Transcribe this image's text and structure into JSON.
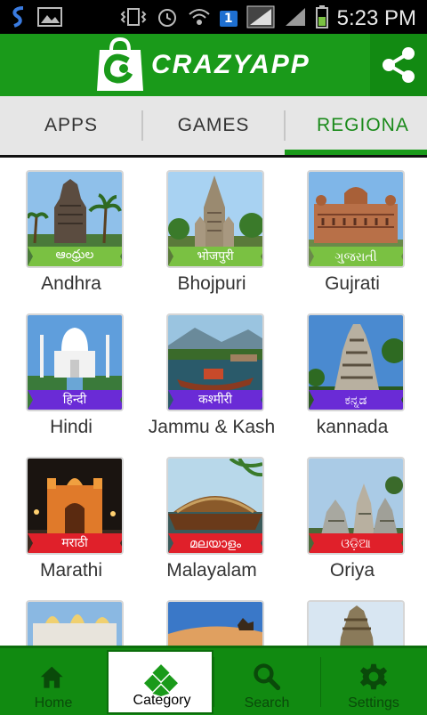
{
  "status_bar": {
    "time": "5:23 PM",
    "notification_count": "1"
  },
  "app": {
    "title": "CRAZYAPP"
  },
  "tabs": [
    {
      "label": "APPS"
    },
    {
      "label": "GAMES"
    },
    {
      "label": "REGIONA"
    }
  ],
  "selected_tab": 2,
  "categories": [
    {
      "name": "Andhra",
      "script": "ఆంధ్రుల",
      "ribbon_color": "#7ac142"
    },
    {
      "name": "Bhojpuri",
      "script": "भोजपुरी",
      "ribbon_color": "#7ac142"
    },
    {
      "name": "Gujrati",
      "script": "ગુજરાતી",
      "ribbon_color": "#7ac142"
    },
    {
      "name": "Hindi",
      "script": "हिन्दी",
      "ribbon_color": "#6a2bd6"
    },
    {
      "name": "Jammu & Kash",
      "script": "कश्मीरी",
      "ribbon_color": "#6a2bd6"
    },
    {
      "name": "kannada",
      "script": "ಕನ್ನಡ",
      "ribbon_color": "#6a2bd6"
    },
    {
      "name": "Marathi",
      "script": "मराठी",
      "ribbon_color": "#e0202a"
    },
    {
      "name": "Malayalam",
      "script": "മലയാളം",
      "ribbon_color": "#e0202a"
    },
    {
      "name": "Oriya",
      "script": "ଓଡ଼ିଆ",
      "ribbon_color": "#e0202a"
    }
  ],
  "bottom_nav": [
    {
      "label": "Home",
      "icon": "home-icon"
    },
    {
      "label": "Category",
      "icon": "category-icon"
    },
    {
      "label": "Search",
      "icon": "search-icon"
    },
    {
      "label": "Settings",
      "icon": "gear-icon"
    }
  ],
  "colors": {
    "brand_green": "#1a9a1a",
    "dark_green": "#118a11"
  }
}
